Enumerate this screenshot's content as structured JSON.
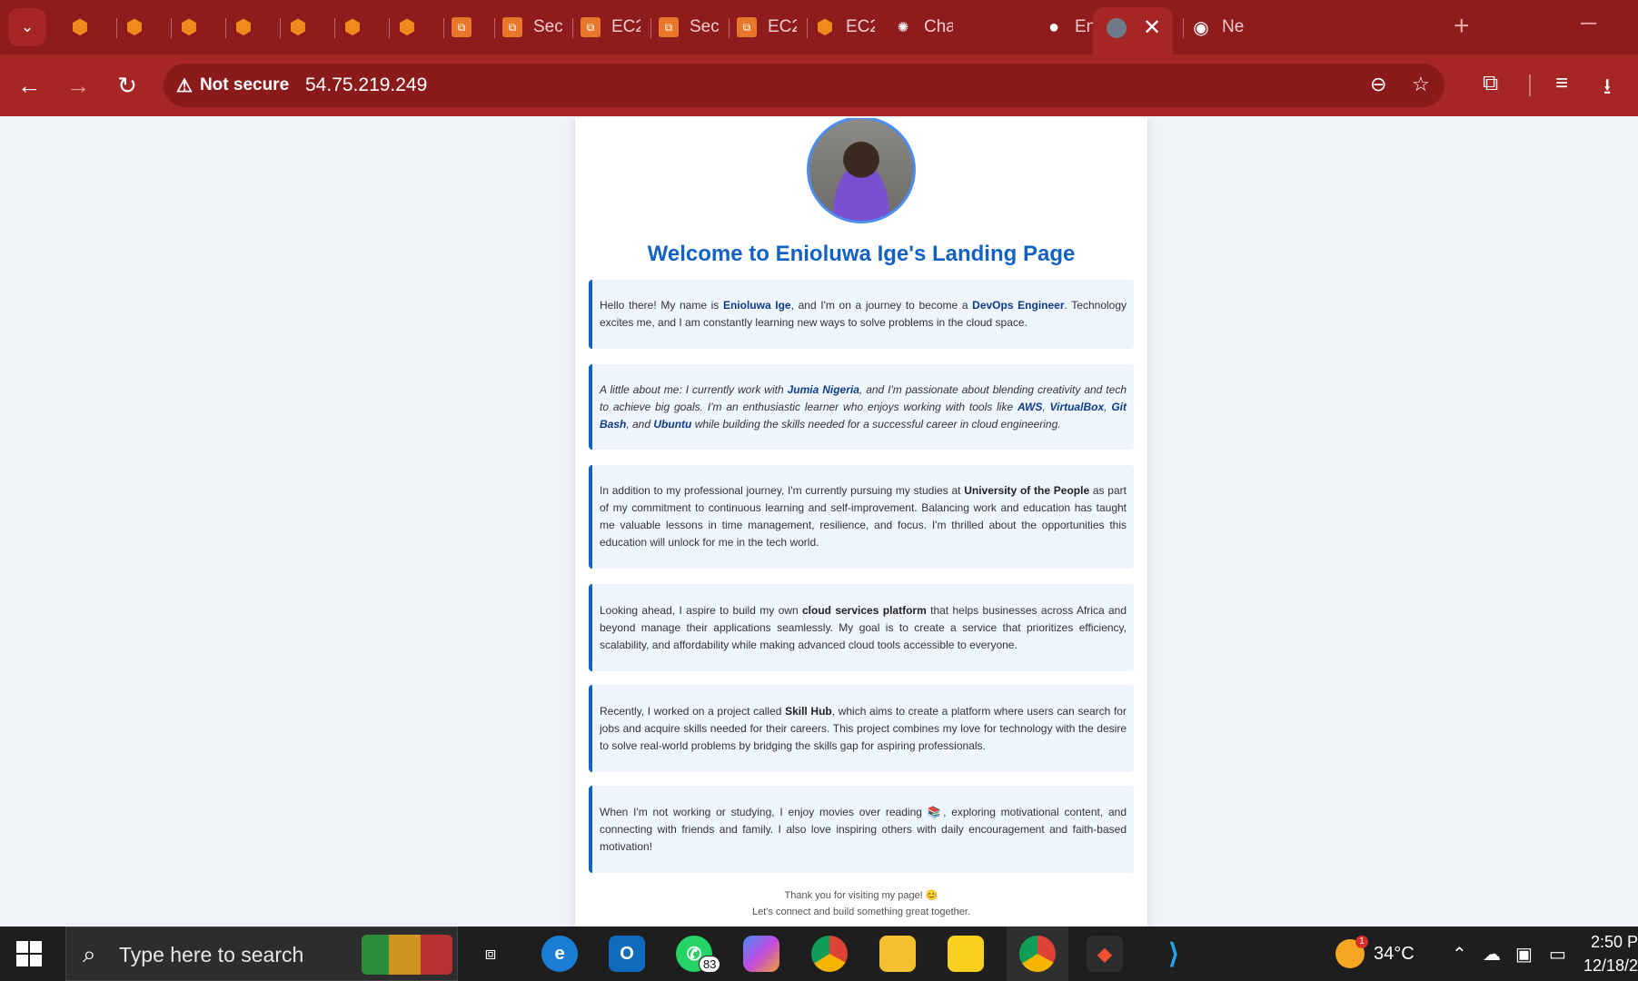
{
  "browser": {
    "tabs": [
      {
        "title": "",
        "icon": "cube-icon"
      },
      {
        "title": "",
        "icon": "cube-icon"
      },
      {
        "title": "",
        "icon": "cube-icon"
      },
      {
        "title": "",
        "icon": "cube-icon"
      },
      {
        "title": "",
        "icon": "cube-icon"
      },
      {
        "title": "",
        "icon": "cube-icon"
      },
      {
        "title": "",
        "icon": "cube-icon"
      },
      {
        "title": "",
        "icon": "aws-ec2-icon"
      },
      {
        "title": "Sec",
        "icon": "aws-ec2-icon"
      },
      {
        "title": "EC2",
        "icon": "aws-ec2-icon"
      },
      {
        "title": "Sec",
        "icon": "aws-ec2-icon"
      },
      {
        "title": "EC2",
        "icon": "aws-ec2-icon"
      },
      {
        "title": "EC2",
        "icon": "cube-icon"
      },
      {
        "title": "Cha",
        "icon": "chatgpt-icon"
      },
      {
        "title": "Eni",
        "icon": "github-icon"
      },
      {
        "title": "",
        "icon": "youtube-icon"
      },
      {
        "title": "",
        "icon": "picture-in-picture-icon"
      },
      {
        "title": "Ne",
        "icon": "chrome-icon"
      }
    ],
    "active_tab_close": "✕",
    "new_tab": "+",
    "security_label": "Not secure",
    "url": "54.75.219.249",
    "accent": "#a62626"
  },
  "page": {
    "title": "Welcome to Enioluwa Ige's Landing Page",
    "sections": [
      [
        {
          "t": "Hello there! My name is "
        },
        {
          "t": "Enioluwa Ige",
          "s": "hl"
        },
        {
          "t": ", and I'm on a journey to become a "
        },
        {
          "t": "DevOps Engineer",
          "s": "hl"
        },
        {
          "t": ". Technology excites me, and I am constantly learning new ways to solve problems in the cloud space."
        }
      ],
      [
        {
          "t": "A little about me: I currently work with "
        },
        {
          "t": "Jumia Nigeria",
          "s": "hl"
        },
        {
          "t": ", and I'm passionate about blending creativity and tech to achieve big goals. I'm an enthusiastic learner who enjoys working with tools like "
        },
        {
          "t": "AWS",
          "s": "hl"
        },
        {
          "t": ", "
        },
        {
          "t": "VirtualBox",
          "s": "hl"
        },
        {
          "t": ", "
        },
        {
          "t": "Git Bash",
          "s": "hl"
        },
        {
          "t": ", and "
        },
        {
          "t": "Ubuntu",
          "s": "hl"
        },
        {
          "t": " while building the skills needed for a successful career in cloud engineering."
        }
      ],
      [
        {
          "t": "In addition to my professional journey, I'm currently pursuing my studies at "
        },
        {
          "t": "University of the People",
          "s": "b"
        },
        {
          "t": " as part of my commitment to continuous learning and self-improvement. Balancing work and education has taught me valuable lessons in time management, resilience, and focus. I'm thrilled about the opportunities this education will unlock for me in the tech world."
        }
      ],
      [
        {
          "t": "Looking ahead, I aspire to build my own "
        },
        {
          "t": "cloud services platform",
          "s": "b"
        },
        {
          "t": " that helps businesses across Africa and beyond manage their applications seamlessly. My goal is to create a service that prioritizes efficiency, scalability, and affordability while making advanced cloud tools accessible to everyone."
        }
      ],
      [
        {
          "t": "Recently, I worked on a project called "
        },
        {
          "t": "Skill Hub",
          "s": "b"
        },
        {
          "t": ", which aims to create a platform where users can search for jobs and acquire skills needed for their careers. This project combines my love for technology with the desire to solve real-world problems by bridging the skills gap for aspiring professionals."
        }
      ],
      [
        {
          "t": "When I'm not working or studying, I enjoy movies over reading 📚, exploring motivational content, and connecting with friends and family. I also love inspiring others with daily encouragement and faith-based motivation!"
        }
      ]
    ],
    "footer_line1": "Thank you for visiting my page! 😊",
    "footer_line2": "Let's connect and build something great together."
  },
  "taskbar": {
    "search_placeholder": "Type here to search",
    "whatsapp_badge": "83",
    "weather_alert": "1",
    "temperature": "34°C",
    "time": "2:50 P",
    "date": "12/18/2"
  }
}
